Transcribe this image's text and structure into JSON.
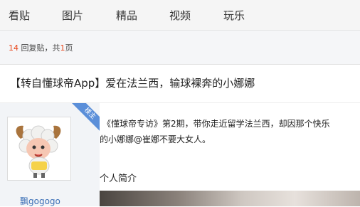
{
  "nav": {
    "items": [
      {
        "label": "看贴"
      },
      {
        "label": "图片"
      },
      {
        "label": "精品"
      },
      {
        "label": "视频"
      },
      {
        "label": "玩乐"
      }
    ]
  },
  "pager": {
    "count": "14",
    "text_a": " 回复贴，共",
    "pages": "1",
    "text_b": "页"
  },
  "post": {
    "title": "【转自懂球帝App】爱在法兰西，输球裸奔的小娜娜",
    "badge": "楼主",
    "author": "飘gogogo",
    "lines": [
      "《懂球帝专访》第2期，带你走近留学法兰西，却因那个快乐",
      "的小娜娜@崔娜不要大女人。"
    ],
    "section_heading": "个人简介"
  },
  "colors": {
    "accent": "#e8471c",
    "link": "#3b6fb6",
    "badge": "#5b8fd9"
  }
}
